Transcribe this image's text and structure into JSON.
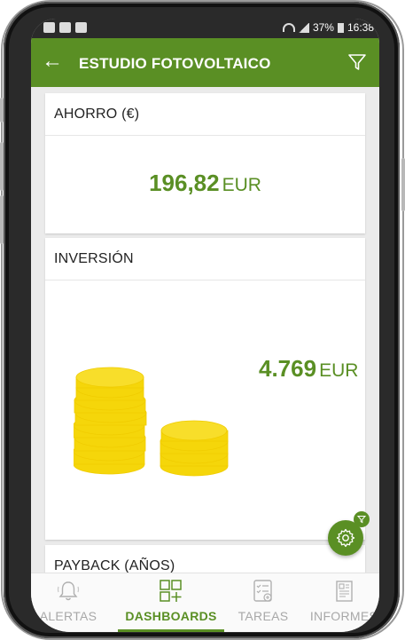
{
  "status": {
    "battery": "37%",
    "time": "16:38"
  },
  "appbar": {
    "title": "ESTUDIO FOTOVOLTAICO"
  },
  "cards": {
    "ahorro": {
      "title": "AHORRO (€)",
      "value": "196,82",
      "unit": "EUR"
    },
    "inversion": {
      "title": "INVERSIÓN",
      "value": "4.769",
      "unit": "EUR"
    },
    "payback": {
      "title": "PAYBACK (AÑOS)"
    }
  },
  "nav": {
    "items": [
      {
        "label": "ALERTAS",
        "icon": "bell-icon"
      },
      {
        "label": "DASHBOARDS",
        "icon": "dashboard-icon"
      },
      {
        "label": "TAREAS",
        "icon": "tasks-icon"
      },
      {
        "label": "INFORMES",
        "icon": "reports-icon"
      }
    ],
    "active": "DASHBOARDS"
  },
  "colors": {
    "primary": "#5a8f24",
    "coin": "#f5d60a"
  }
}
